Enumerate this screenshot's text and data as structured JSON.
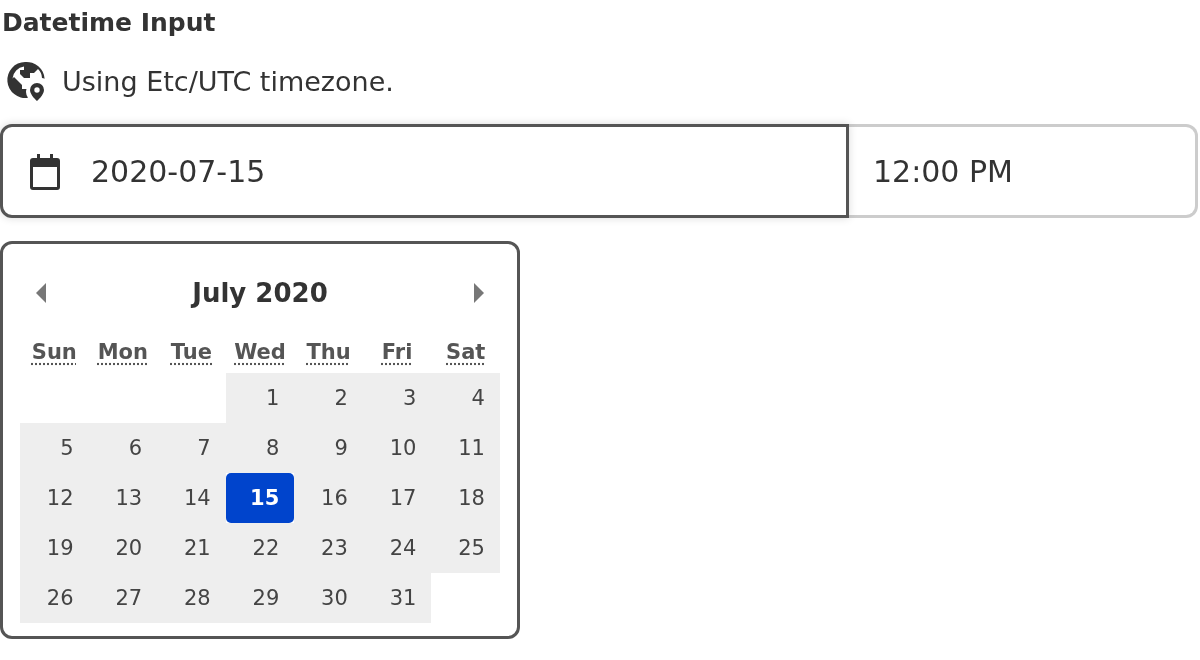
{
  "title": "Datetime Input",
  "timezone_note": "Using Etc/UTC timezone.",
  "date_field": {
    "value": "2020-07-15",
    "focused": true
  },
  "time_field": {
    "value": "12:00 PM",
    "focused": false
  },
  "calendar": {
    "month_title": "July 2020",
    "weekdays": [
      "Sun",
      "Mon",
      "Tue",
      "Wed",
      "Thu",
      "Fri",
      "Sat"
    ],
    "weeks": [
      {
        "kind": "first",
        "days": [
          {
            "label": "1",
            "selected": false
          },
          {
            "label": "2",
            "selected": false
          },
          {
            "label": "3",
            "selected": false
          },
          {
            "label": "4",
            "selected": false
          }
        ]
      },
      {
        "kind": "full",
        "days": [
          {
            "label": "5",
            "selected": false
          },
          {
            "label": "6",
            "selected": false
          },
          {
            "label": "7",
            "selected": false
          },
          {
            "label": "8",
            "selected": false
          },
          {
            "label": "9",
            "selected": false
          },
          {
            "label": "10",
            "selected": false
          },
          {
            "label": "11",
            "selected": false
          }
        ]
      },
      {
        "kind": "full",
        "days": [
          {
            "label": "12",
            "selected": false
          },
          {
            "label": "13",
            "selected": false
          },
          {
            "label": "14",
            "selected": false
          },
          {
            "label": "15",
            "selected": true
          },
          {
            "label": "16",
            "selected": false
          },
          {
            "label": "17",
            "selected": false
          },
          {
            "label": "18",
            "selected": false
          }
        ]
      },
      {
        "kind": "full",
        "days": [
          {
            "label": "19",
            "selected": false
          },
          {
            "label": "20",
            "selected": false
          },
          {
            "label": "21",
            "selected": false
          },
          {
            "label": "22",
            "selected": false
          },
          {
            "label": "23",
            "selected": false
          },
          {
            "label": "24",
            "selected": false
          },
          {
            "label": "25",
            "selected": false
          }
        ]
      },
      {
        "kind": "last",
        "days": [
          {
            "label": "26",
            "selected": false
          },
          {
            "label": "27",
            "selected": false
          },
          {
            "label": "28",
            "selected": false
          },
          {
            "label": "29",
            "selected": false
          },
          {
            "label": "30",
            "selected": false
          },
          {
            "label": "31",
            "selected": false
          }
        ]
      }
    ]
  }
}
